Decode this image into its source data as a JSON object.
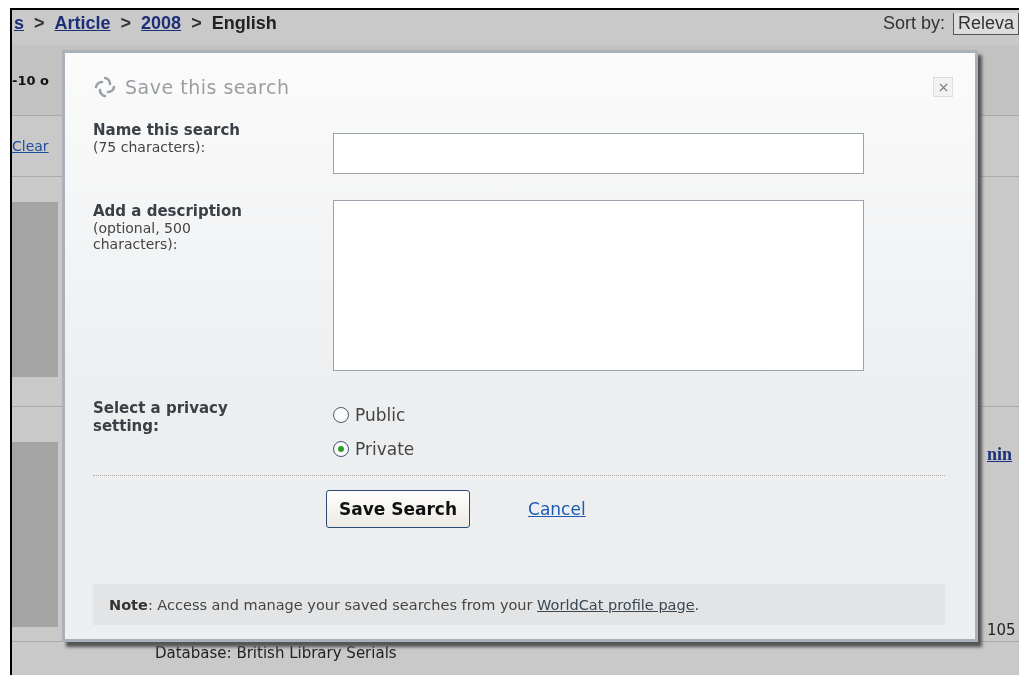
{
  "background_page": {
    "breadcrumb": [
      {
        "text": "s",
        "link": true
      },
      {
        "text": "Article",
        "link": true
      },
      {
        "text": "2008",
        "link": true
      },
      {
        "text": "English",
        "link": false
      }
    ],
    "separator": ">",
    "sort_label": "Sort by:",
    "sort_value": "Releva",
    "results_range": "-10 o",
    "clear_link": "Clear",
    "result_title_fragment": "nin",
    "result_number_fragment": "105",
    "database_line": "Database: British Library Serials"
  },
  "dialog": {
    "title": "Save this search",
    "name_field": {
      "label": "Name this search",
      "hint": "(75 characters):"
    },
    "description_field": {
      "label": "Add a description",
      "hint": "(optional, 500 characters):"
    },
    "privacy": {
      "label": "Select a privacy setting:",
      "options": [
        {
          "label": "Public",
          "selected": false
        },
        {
          "label": "Private",
          "selected": true
        }
      ]
    },
    "save_button": "Save Search",
    "cancel_link": "Cancel",
    "note": {
      "text": "**Note**: Access and manage your saved searches from your ",
      "link": "WorldCat profile page",
      "after": "."
    }
  }
}
